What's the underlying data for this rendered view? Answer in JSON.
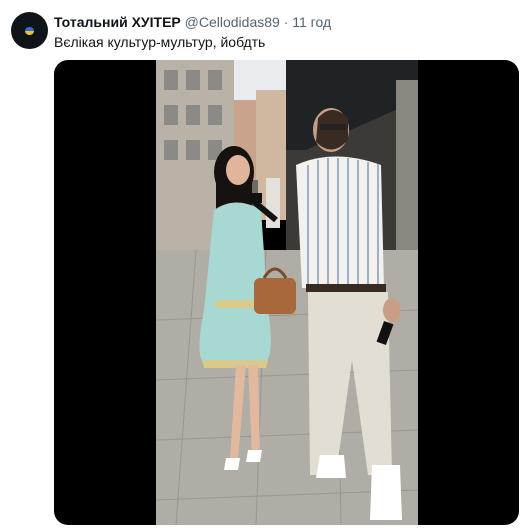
{
  "tweet": {
    "display_name": "Тотальний ХУІТЕР",
    "handle": "@Cellodidas89",
    "separator": "·",
    "time": "11 год",
    "text": "Вєлікая культур-мультур, йобдть"
  },
  "avatar": {
    "flag_colors": [
      "#2f6fd6",
      "#f2c230"
    ]
  },
  "media": {
    "type": "video-still"
  }
}
